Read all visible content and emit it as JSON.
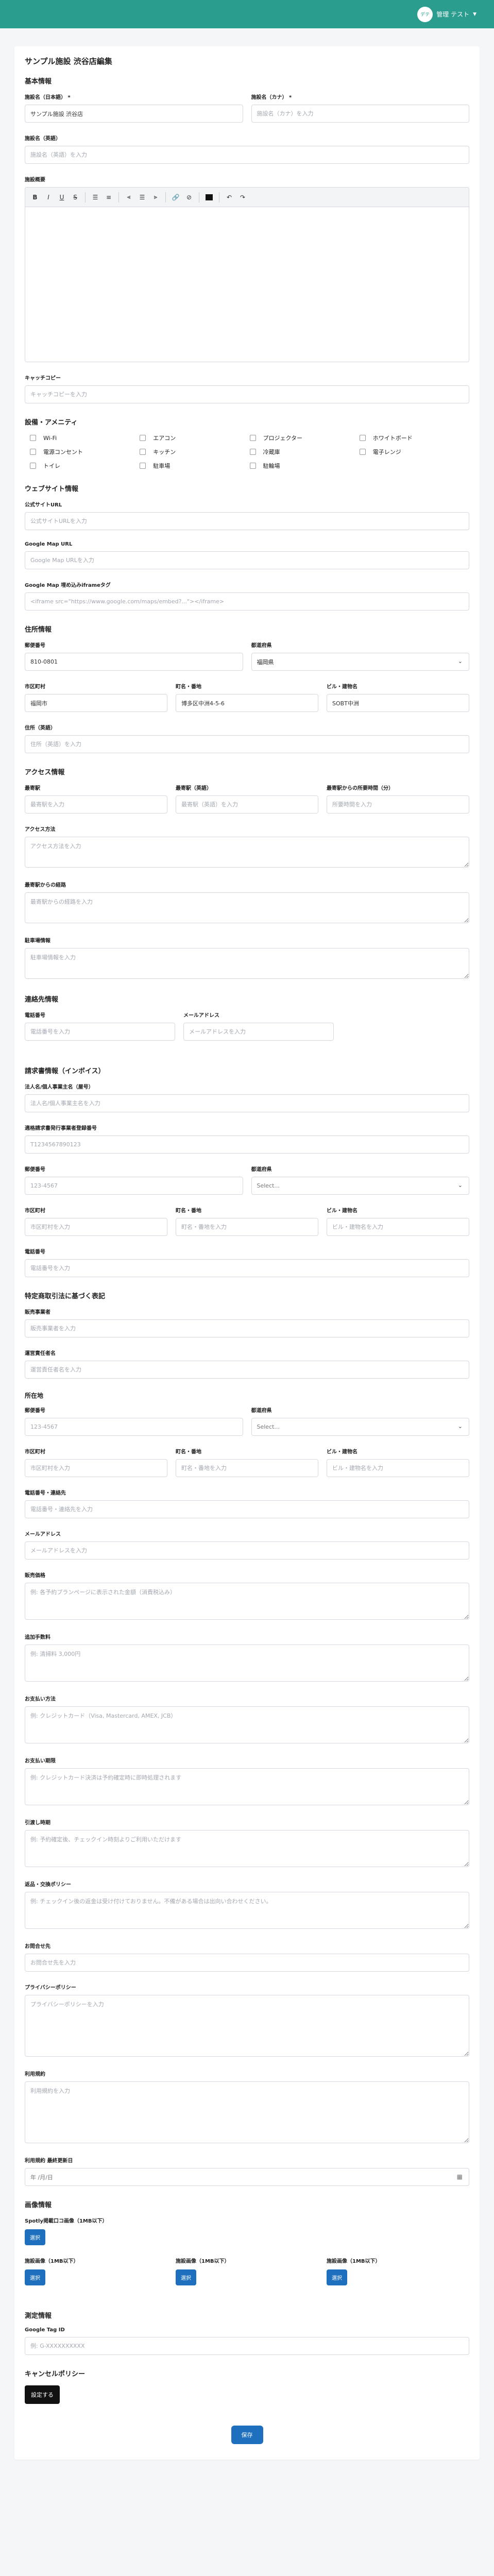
{
  "header": {
    "avatar": "デテ",
    "user_name": "管理 テスト"
  },
  "page_title": "サンプル施設 渋谷店編集",
  "basic": {
    "heading": "基本情報",
    "name_ja_label": "施設名（日本語） *",
    "name_ja_value": "サンプル施設 渋谷店",
    "name_kana_label": "施設名（カナ） *",
    "name_kana_ph": "施設名（カナ）を入力",
    "name_en_label": "施設名（英語）",
    "name_en_ph": "施設名（英語）を入力",
    "desc_label": "施設概要",
    "catch_label": "キャッチコピー",
    "catch_ph": "キャッチコピーを入力"
  },
  "amenities": {
    "heading": "設備・アメニティ",
    "items": [
      "Wi-Fi",
      "エアコン",
      "プロジェクター",
      "ホワイトボード",
      "電源コンセント",
      "キッチン",
      "冷蔵庫",
      "電子レンジ",
      "トイレ",
      "駐車場",
      "駐輪場"
    ]
  },
  "website": {
    "heading": "ウェブサイト情報",
    "url_label": "公式サイトURL",
    "url_ph": "公式サイトURLを入力",
    "gmap_label": "Google Map URL",
    "gmap_ph": "Google Map URLを入力",
    "iframe_label": "Google Map 埋め込みiframeタグ",
    "iframe_ph": "<iframe src=\"https://www.google.com/maps/embed?...\"></iframe>"
  },
  "address": {
    "heading": "住所情報",
    "zip_label": "郵便番号",
    "zip_value": "810-0801",
    "pref_label": "都道府県",
    "pref_value": "福岡県",
    "city_label": "市区町村",
    "city_value": "福岡市",
    "town_label": "町名・番地",
    "town_value": "博多区中洲4-5-6",
    "bldg_label": "ビル・建物名",
    "bldg_value": "SOBT中洲",
    "en_label": "住所（英語）",
    "en_ph": "住所（英語）を入力"
  },
  "access": {
    "heading": "アクセス情報",
    "station_label": "最寄駅",
    "station_ph": "最寄駅を入力",
    "station_en_label": "最寄駅（英語）",
    "station_en_ph": "最寄駅（英語）を入力",
    "walk_label": "最寄駅からの所要時間（分）",
    "walk_ph": "所要時間を入力",
    "method_label": "アクセス方法",
    "method_ph": "アクセス方法を入力",
    "route_label": "最寄駅からの経路",
    "route_ph": "最寄駅からの経路を入力",
    "parking_label": "駐車場情報",
    "parking_ph": "駐車場情報を入力"
  },
  "contact": {
    "heading": "連絡先情報",
    "tel_label": "電話番号",
    "tel_ph": "電話番号を入力",
    "mail_label": "メールアドレス",
    "mail_ph": "メールアドレスを入力"
  },
  "invoice": {
    "heading": "請求書情報（インボイス）",
    "corp_label": "法人名/個人事業主名（屋号）",
    "corp_ph": "法人名/個人事業主名を入力",
    "reg_label": "適格請求書発行事業者登録番号",
    "reg_ph": "T1234567890123",
    "zip_label": "郵便番号",
    "zip_ph": "123-4567",
    "pref_label": "都道府県",
    "pref_ph": "Select...",
    "city_label": "市区町村",
    "city_ph": "市区町村を入力",
    "town_label": "町名・番地",
    "town_ph": "町名・番地を入力",
    "bldg_label": "ビル・建物名",
    "bldg_ph": "ビル・建物名を入力",
    "tel_label": "電話番号",
    "tel_ph": "電話番号を入力"
  },
  "tokushoho": {
    "heading": "特定商取引法に基づく表記",
    "seller_label": "販売事業者",
    "seller_ph": "販売事業者を入力",
    "manager_label": "運営責任者名",
    "manager_ph": "運営責任者名を入力",
    "loc_heading": "所在地",
    "zip_label": "郵便番号",
    "zip_ph": "123-4567",
    "pref_label": "都道府県",
    "pref_ph": "Select...",
    "city_label": "市区町村",
    "city_ph": "市区町村を入力",
    "town_label": "町名・番地",
    "town_ph": "町名・番地を入力",
    "bldg_label": "ビル・建物名",
    "bldg_ph": "ビル・建物名を入力",
    "tel_label": "電話番号・連絡先",
    "tel_ph": "電話番号・連絡先を入力",
    "mail_label": "メールアドレス",
    "mail_ph": "メールアドレスを入力",
    "price_label": "販売価格",
    "price_ph": "例: 各予約プランページに表示された金額（消費税込み）",
    "fee_label": "追加手数料",
    "fee_ph": "例: 清掃料 3,000円",
    "pay_label": "お支払い方法",
    "pay_ph": "例: クレジットカード（Visa, Mastercard, AMEX, JCB）",
    "paytime_label": "お支払い期限",
    "paytime_ph": "例: クレジットカード決済は予約確定時に即時処理されます",
    "delivery_label": "引渡し時期",
    "delivery_ph": "例: 予約確定後、チェックイン時刻よりご利用いただけます",
    "return_label": "返品・交換ポリシー",
    "return_ph": "例: チェックイン後の返金は受け付けておりません。不備がある場合は出向い合わせください。",
    "inquiry_label": "お問合せ先",
    "inquiry_ph": "お問合せ先を入力",
    "privacy_label": "プライバシーポリシー",
    "privacy_ph": "プライバシーポリシーを入力",
    "terms_label": "利用規約",
    "terms_ph": "利用規約を入力",
    "terms_date_label": "利用規約 最終更新日",
    "terms_date_ph": "年 /月/日"
  },
  "images": {
    "heading": "画像情報",
    "spotly_label": "Spotly掲載口コ画像（1MB以下）",
    "f1_label": "施設画像（1MB以下）",
    "f2_label": "施設画像（1MB以下）",
    "f3_label": "施設画像（1MB以下）",
    "select_btn": "選択"
  },
  "measurement": {
    "heading": "測定情報",
    "gtag_label": "Google Tag ID",
    "gtag_ph": "例: G-XXXXXXXXXX"
  },
  "cancel": {
    "heading": "キャンセルポリシー",
    "set_btn": "設定する"
  },
  "save_btn": "保存",
  "toolbar_icons": [
    "bold-icon",
    "italic-icon",
    "underline-icon",
    "strikethrough-icon",
    "bullet-list-icon",
    "numbered-list-icon",
    "align-left-icon",
    "align-center-icon",
    "align-right-icon",
    "link-icon",
    "unlink-icon",
    "text-color-icon",
    "undo-icon",
    "redo-icon"
  ]
}
